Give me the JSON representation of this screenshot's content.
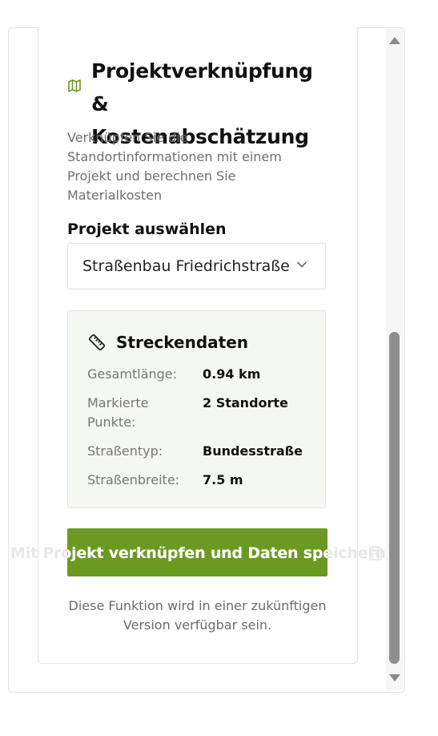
{
  "section": {
    "icon": "map-icon",
    "title": "Projektverknüpfung & Kostenabschätzung",
    "description": "Verknüpfen Sie die Standortinformationen mit einem Projekt und berechnen Sie Materialkosten"
  },
  "project_select": {
    "label": "Projekt auswählen",
    "value": "Straßenbau Friedrichstraße",
    "icon": "chevron-down-icon"
  },
  "route_data": {
    "icon": "ruler-icon",
    "title": "Streckendaten",
    "rows": [
      {
        "label": "Gesamtlänge:",
        "value": "0.94 km"
      },
      {
        "label": "Markierte Punkte:",
        "value": "2 Standorte"
      },
      {
        "label": "Straßentyp:",
        "value": "Bundesstraße"
      },
      {
        "label": "Straßenbreite:",
        "value": "7.5 m"
      }
    ]
  },
  "link_button": {
    "label": "Mit Projekt verknüpfen und Daten speichern",
    "icon": "save-icon"
  },
  "note": "Diese Funktion wird in einer zukünftigen Version verfügbar sein.",
  "colors": {
    "accent": "#6b9a22",
    "panel_bg": "#f5f7f2",
    "muted_text": "#6f6f6f"
  }
}
